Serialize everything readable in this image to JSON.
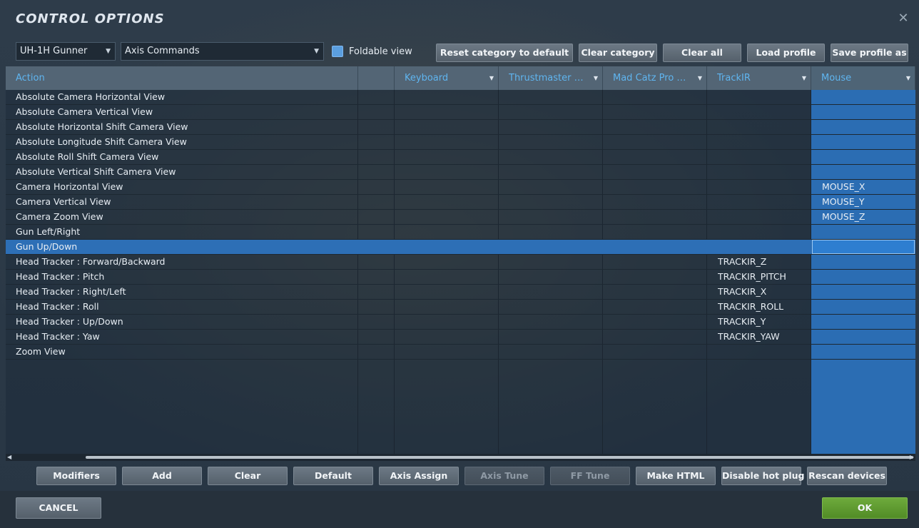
{
  "window": {
    "title": "CONTROL OPTIONS",
    "close_glyph": "✕"
  },
  "filters": {
    "aircraft": "UH-1H Gunner",
    "category": "Axis Commands",
    "foldable_label": "Foldable view",
    "foldable_checked": true
  },
  "toolbar": {
    "reset_category": "Reset category to default",
    "clear_category": "Clear category",
    "clear_all": "Clear all",
    "load_profile": "Load profile",
    "save_profile": "Save profile as"
  },
  "columns": {
    "action": "Action",
    "keyboard": "Keyboard",
    "thrustmaster": "Thrustmaster H...",
    "madcatz": "Mad Catz Pro Fli...",
    "trackir": "TrackIR",
    "mouse": "Mouse"
  },
  "rows": [
    {
      "action": "Absolute Camera Horizontal View",
      "trackir": "",
      "mouse": ""
    },
    {
      "action": "Absolute Camera Vertical View",
      "trackir": "",
      "mouse": ""
    },
    {
      "action": "Absolute Horizontal Shift Camera View",
      "trackir": "",
      "mouse": ""
    },
    {
      "action": "Absolute Longitude Shift Camera View",
      "trackir": "",
      "mouse": ""
    },
    {
      "action": "Absolute Roll Shift Camera View",
      "trackir": "",
      "mouse": ""
    },
    {
      "action": "Absolute Vertical Shift Camera View",
      "trackir": "",
      "mouse": ""
    },
    {
      "action": "Camera Horizontal View",
      "trackir": "",
      "mouse": "MOUSE_X"
    },
    {
      "action": "Camera Vertical View",
      "trackir": "",
      "mouse": "MOUSE_Y"
    },
    {
      "action": "Camera Zoom View",
      "trackir": "",
      "mouse": "MOUSE_Z"
    },
    {
      "action": "Gun Left/Right",
      "trackir": "",
      "mouse": ""
    },
    {
      "action": "Gun Up/Down",
      "trackir": "",
      "mouse": "",
      "selected": true
    },
    {
      "action": "Head Tracker : Forward/Backward",
      "trackir": "TRACKIR_Z",
      "mouse": ""
    },
    {
      "action": "Head Tracker : Pitch",
      "trackir": "TRACKIR_PITCH",
      "mouse": ""
    },
    {
      "action": "Head Tracker : Right/Left",
      "trackir": "TRACKIR_X",
      "mouse": ""
    },
    {
      "action": "Head Tracker : Roll",
      "trackir": "TRACKIR_ROLL",
      "mouse": ""
    },
    {
      "action": "Head Tracker : Up/Down",
      "trackir": "TRACKIR_Y",
      "mouse": ""
    },
    {
      "action": "Head Tracker : Yaw",
      "trackir": "TRACKIR_YAW",
      "mouse": ""
    },
    {
      "action": "Zoom View",
      "trackir": "",
      "mouse": ""
    }
  ],
  "bottom_buttons": {
    "modifiers": "Modifiers",
    "add": "Add",
    "clear": "Clear",
    "default": "Default",
    "axis_assign": "Axis Assign",
    "axis_tune": "Axis Tune",
    "ff_tune": "FF Tune",
    "make_html": "Make HTML",
    "disable_hot_plug": "Disable hot plug",
    "rescan_devices": "Rescan devices"
  },
  "footer": {
    "cancel": "CANCEL",
    "ok": "OK"
  },
  "colors": {
    "accent": "#5fb5f0",
    "selection": "#2d6fb6",
    "ok": "#5a9630"
  }
}
